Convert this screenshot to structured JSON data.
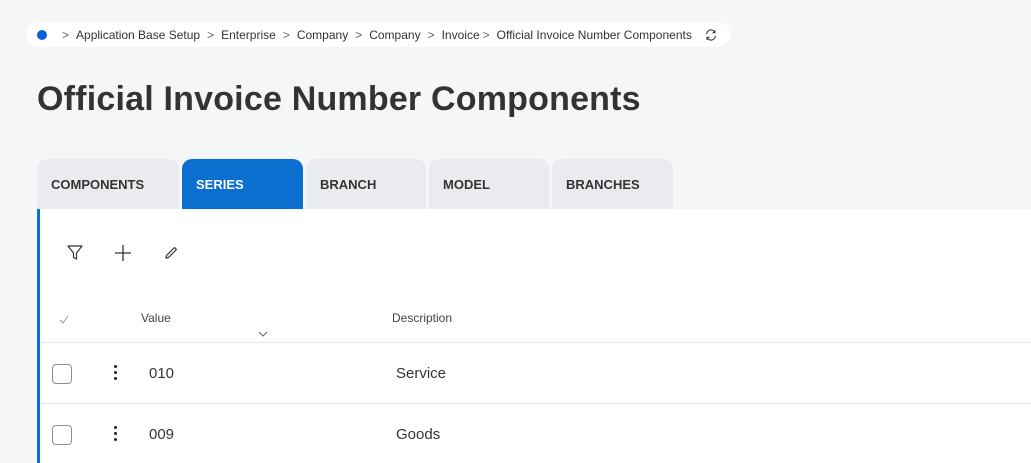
{
  "breadcrumb": {
    "items": [
      "Application Base Setup",
      "Enterprise",
      "Company",
      "Company",
      "Invoice",
      "Official Invoice Number Components"
    ]
  },
  "page_title": "Official Invoice Number Components",
  "tabs": [
    {
      "label": "COMPONENTS",
      "active": false
    },
    {
      "label": "SERIES",
      "active": true
    },
    {
      "label": "BRANCH",
      "active": false
    },
    {
      "label": "MODEL",
      "active": false
    },
    {
      "label": "BRANCHES",
      "active": false
    }
  ],
  "toolbar": {
    "icons": [
      "filter-icon",
      "add-icon",
      "edit-icon"
    ]
  },
  "table": {
    "columns": [
      "Value",
      "Description"
    ],
    "rows": [
      {
        "value": "010",
        "description": "Service"
      },
      {
        "value": "009",
        "description": "Goods"
      }
    ]
  },
  "colors": {
    "accent": "#0b6fd0",
    "background": "#f5f6f8",
    "tab_inactive": "#e9ebee"
  }
}
